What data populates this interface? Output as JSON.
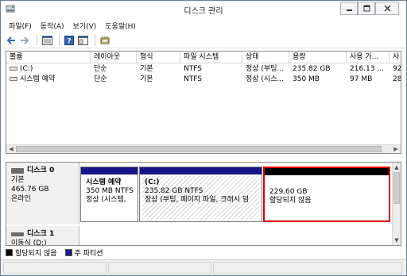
{
  "window": {
    "title": "디스크 관리"
  },
  "menu": [
    "파일(F)",
    "동작(A)",
    "보기(V)",
    "도움말(H)"
  ],
  "toolbar": {
    "icons": [
      "back-arrow-icon",
      "forward-arrow-icon",
      "view-list-icon",
      "help-icon",
      "properties-icon",
      "disk-wizard-icon"
    ]
  },
  "volumes": {
    "columns": [
      "볼륨",
      "레이아웃",
      "형식",
      "파일 시스템",
      "상태",
      "용량",
      "사용 가...",
      "사"
    ],
    "rows": [
      [
        "(C:)",
        "단순",
        "기본",
        "NTFS",
        "정상 (부팅...",
        "235.82 GB",
        "216.13 ...",
        "92"
      ],
      [
        "시스템 예약",
        "단순",
        "기본",
        "NTFS",
        "정상 (시스...",
        "350 MB",
        "97 MB",
        "28"
      ]
    ]
  },
  "disks": [
    {
      "name": "디스크 0",
      "lines": [
        "기본",
        "465.76 GB",
        "온라인"
      ],
      "partitions": [
        {
          "name": "시스템 예약",
          "size": "350 MB NTFS",
          "status": "정상 (시스템,",
          "type": "primary"
        },
        {
          "name": "(C:)",
          "size": "235.82 GB NTFS",
          "status": "정상 (부팅, 페이지 파일, 크래시 덤",
          "type": "primary"
        },
        {
          "name": "",
          "size": "229.60 GB",
          "status": "할당되지 않음",
          "type": "unallocated"
        }
      ]
    },
    {
      "name": "디스크 1",
      "lines": [
        "이동식 (D:)"
      ]
    }
  ],
  "legend": [
    {
      "label": "할당되지 않음",
      "color": "#000000"
    },
    {
      "label": "주 파티션",
      "color": "#1a1a8c"
    }
  ],
  "colors": {
    "primary_bar": "#16168a",
    "unallocated_bar": "#000000",
    "selection": "#e00000"
  }
}
